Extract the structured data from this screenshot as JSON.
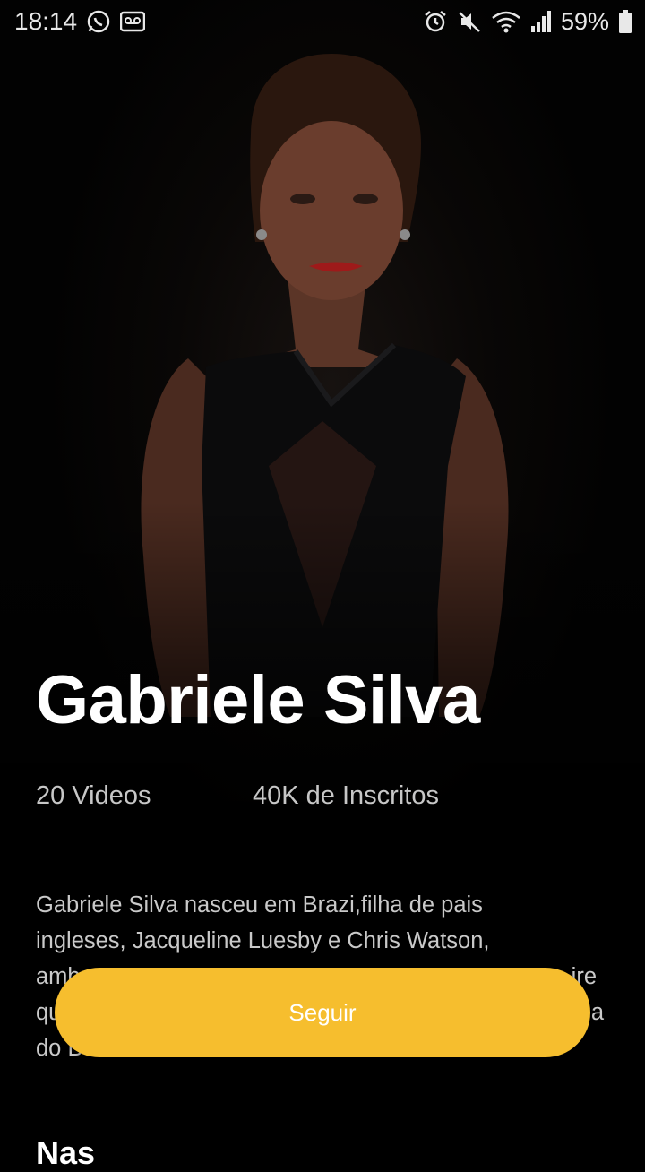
{
  "status_bar": {
    "time": "18:14",
    "battery": "59%",
    "icons": [
      "whatsapp-icon",
      "voicemail-icon",
      "alarm-icon",
      "mute-icon",
      "wifi-icon",
      "signal-icon",
      "battery-icon"
    ]
  },
  "profile": {
    "name": "Gabriele Silva",
    "videos": "20 Videos",
    "subscribers": "40K de Inscritos",
    "bio_lines": [
      "Gabriele Silva nasceu em Brazi,filha de pais",
      "ingleses, Jacqueline Luesby e Chris Watson,",
      "amb",
      "qu",
      "do B"
    ],
    "bio_partial_right": [
      "ire",
      "a"
    ]
  },
  "actions": {
    "follow_label": "Seguir"
  },
  "sections": {
    "next_heading_partial": "Nas"
  },
  "colors": {
    "accent": "#f6be2e",
    "background": "#000000",
    "text_muted": "#c7c7c7"
  }
}
